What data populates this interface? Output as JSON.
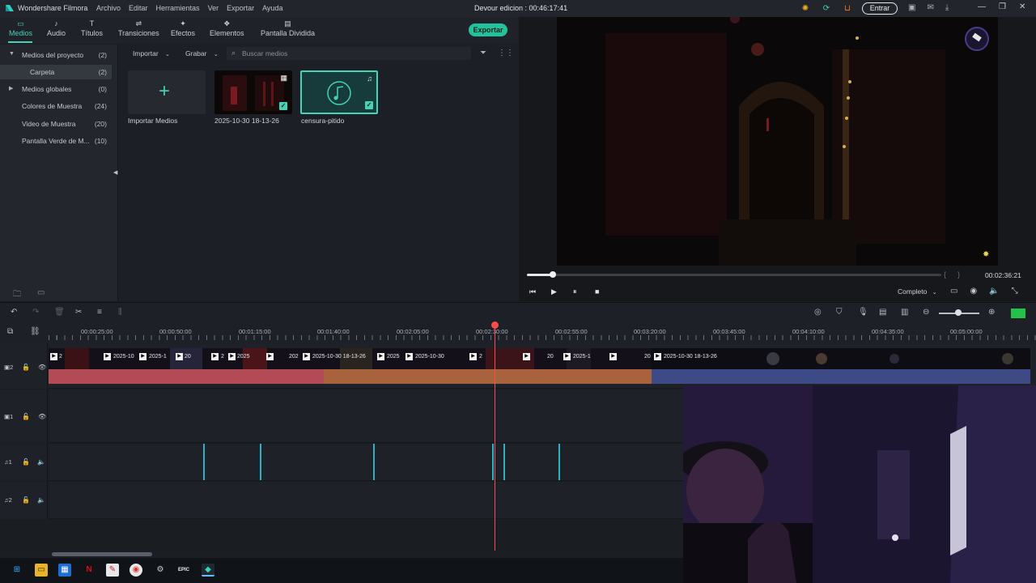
{
  "app": {
    "name": "Wondershare Filmora",
    "project_title": "Devour edicion : 00:46:17:41",
    "menu": [
      "Archivo",
      "Editar",
      "Herramientas",
      "Ver",
      "Exportar",
      "Ayuda"
    ],
    "login_label": "Entrar"
  },
  "tabs": [
    {
      "label": "Medios",
      "icon": "folder-icon",
      "active": true
    },
    {
      "label": "Audio",
      "icon": "music-note-icon"
    },
    {
      "label": "Títulos",
      "icon": "text-t-icon"
    },
    {
      "label": "Transiciones",
      "icon": "transition-icon"
    },
    {
      "label": "Efectos",
      "icon": "effects-icon"
    },
    {
      "label": "Elementos",
      "icon": "elements-icon"
    },
    {
      "label": "Pantalla Dividida",
      "icon": "split-screen-icon"
    }
  ],
  "export_label": "Exportar",
  "sidebar": {
    "items": [
      {
        "label": "Medios del proyecto",
        "count": "(2)",
        "expanded": true
      },
      {
        "label": "Carpeta",
        "count": "(2)",
        "selected": true
      },
      {
        "label": "Medios globales",
        "count": "(0)"
      },
      {
        "label": "Colores de Muestra",
        "count": "(24)"
      },
      {
        "label": "Video de Muestra",
        "count": "(20)"
      },
      {
        "label": "Pantalla Verde de M...",
        "count": "(10)"
      }
    ]
  },
  "media_toolbar": {
    "import_label": "Importar",
    "record_label": "Grabar",
    "search_placeholder": "Buscar medios"
  },
  "media_items": [
    {
      "label": "Importar Medios"
    },
    {
      "label": "2025-10-30 18-13-26"
    },
    {
      "label": "censura-pitido"
    }
  ],
  "preview": {
    "time": "00:02:36:21",
    "progress": 0.06,
    "quality_label": "Completo"
  },
  "ruler": {
    "labels": [
      "00:00:25:00",
      "00:00:50:00",
      "00:01:15:00",
      "00:01:40:00",
      "00:02:05:00",
      "00:02:30:00",
      "00:02:55:00",
      "00:03:20:00",
      "00:03:45:00",
      "00:04:10:00",
      "00:04:35:00",
      "00:05:00:00"
    ]
  },
  "tracks": {
    "video2": "2",
    "video1": "1",
    "audio1": "1",
    "audio2": "2"
  },
  "clip_labels": [
    "2",
    "2025-10",
    "2025-1",
    "20",
    "2",
    "2025",
    "202",
    "2025-10-30 18-13-26",
    "2025",
    "2025-10-30",
    "2",
    "20",
    "2025-1",
    "20",
    "2025-10-30 18-13-26"
  ],
  "colors": {
    "accent": "#45d3b6",
    "export": "#22c39c",
    "playhead": "#ff4a4a"
  }
}
